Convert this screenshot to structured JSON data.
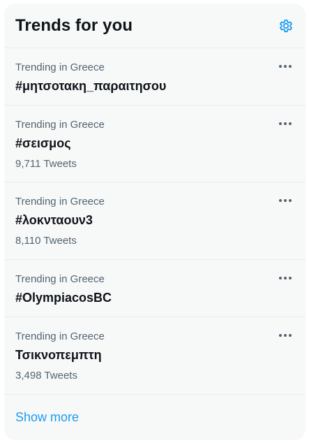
{
  "header": {
    "title": "Trends for you",
    "settings_icon": "gear-icon"
  },
  "colors": {
    "accent": "#1d9bf0",
    "card_bg": "#f7f9f9",
    "secondary_text": "#536471",
    "divider": "#e6ecf0"
  },
  "trends": [
    {
      "context": "Trending in Greece",
      "name": "#μητσοτακη_παραιτησου",
      "count": ""
    },
    {
      "context": "Trending in Greece",
      "name": "#σεισμος",
      "count": "9,711 Tweets"
    },
    {
      "context": "Trending in Greece",
      "name": "#λοκνταουν3",
      "count": "8,110 Tweets"
    },
    {
      "context": "Trending in Greece",
      "name": "#OlympiacosBC",
      "count": ""
    },
    {
      "context": "Trending in Greece",
      "name": "Τσικνοπεμπτη",
      "count": "3,498 Tweets"
    }
  ],
  "more_icon": "more-horizontal-icon",
  "footer": {
    "show_more_label": "Show more"
  }
}
